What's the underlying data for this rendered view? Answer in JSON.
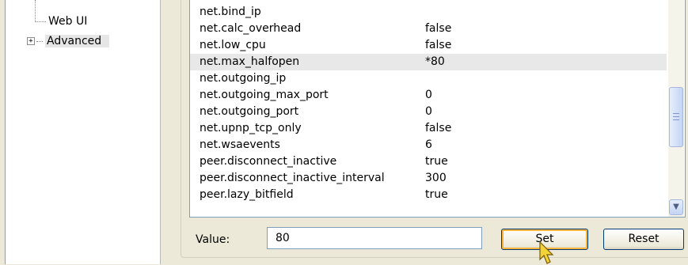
{
  "tree": {
    "items": [
      {
        "label": "Web UI",
        "expander": ""
      },
      {
        "label": "Advanced",
        "expander": "+"
      }
    ]
  },
  "settings": {
    "rows": [
      {
        "key": "net.bind_ip",
        "value": ""
      },
      {
        "key": "net.calc_overhead",
        "value": "false"
      },
      {
        "key": "net.low_cpu",
        "value": "false"
      },
      {
        "key": "net.max_halfopen",
        "value": "*80"
      },
      {
        "key": "net.outgoing_ip",
        "value": ""
      },
      {
        "key": "net.outgoing_max_port",
        "value": "0"
      },
      {
        "key": "net.outgoing_port",
        "value": "0"
      },
      {
        "key": "net.upnp_tcp_only",
        "value": "false"
      },
      {
        "key": "net.wsaevents",
        "value": "6"
      },
      {
        "key": "peer.disconnect_inactive",
        "value": "true"
      },
      {
        "key": "peer.disconnect_inactive_interval",
        "value": "300"
      },
      {
        "key": "peer.lazy_bitfield",
        "value": "true"
      }
    ],
    "selected_key": "net.max_halfopen"
  },
  "value_editor": {
    "label": "Value:",
    "value": "80",
    "set_label": "Set",
    "reset_label": "Reset"
  },
  "icons": {
    "scroll_down": "chevron-down-icon",
    "cursor": "mouse-pointer-icon"
  },
  "colors": {
    "list_border": "#7f9db9",
    "selected_row": "#e8e8e8",
    "button_focus": "#f8b33a"
  }
}
